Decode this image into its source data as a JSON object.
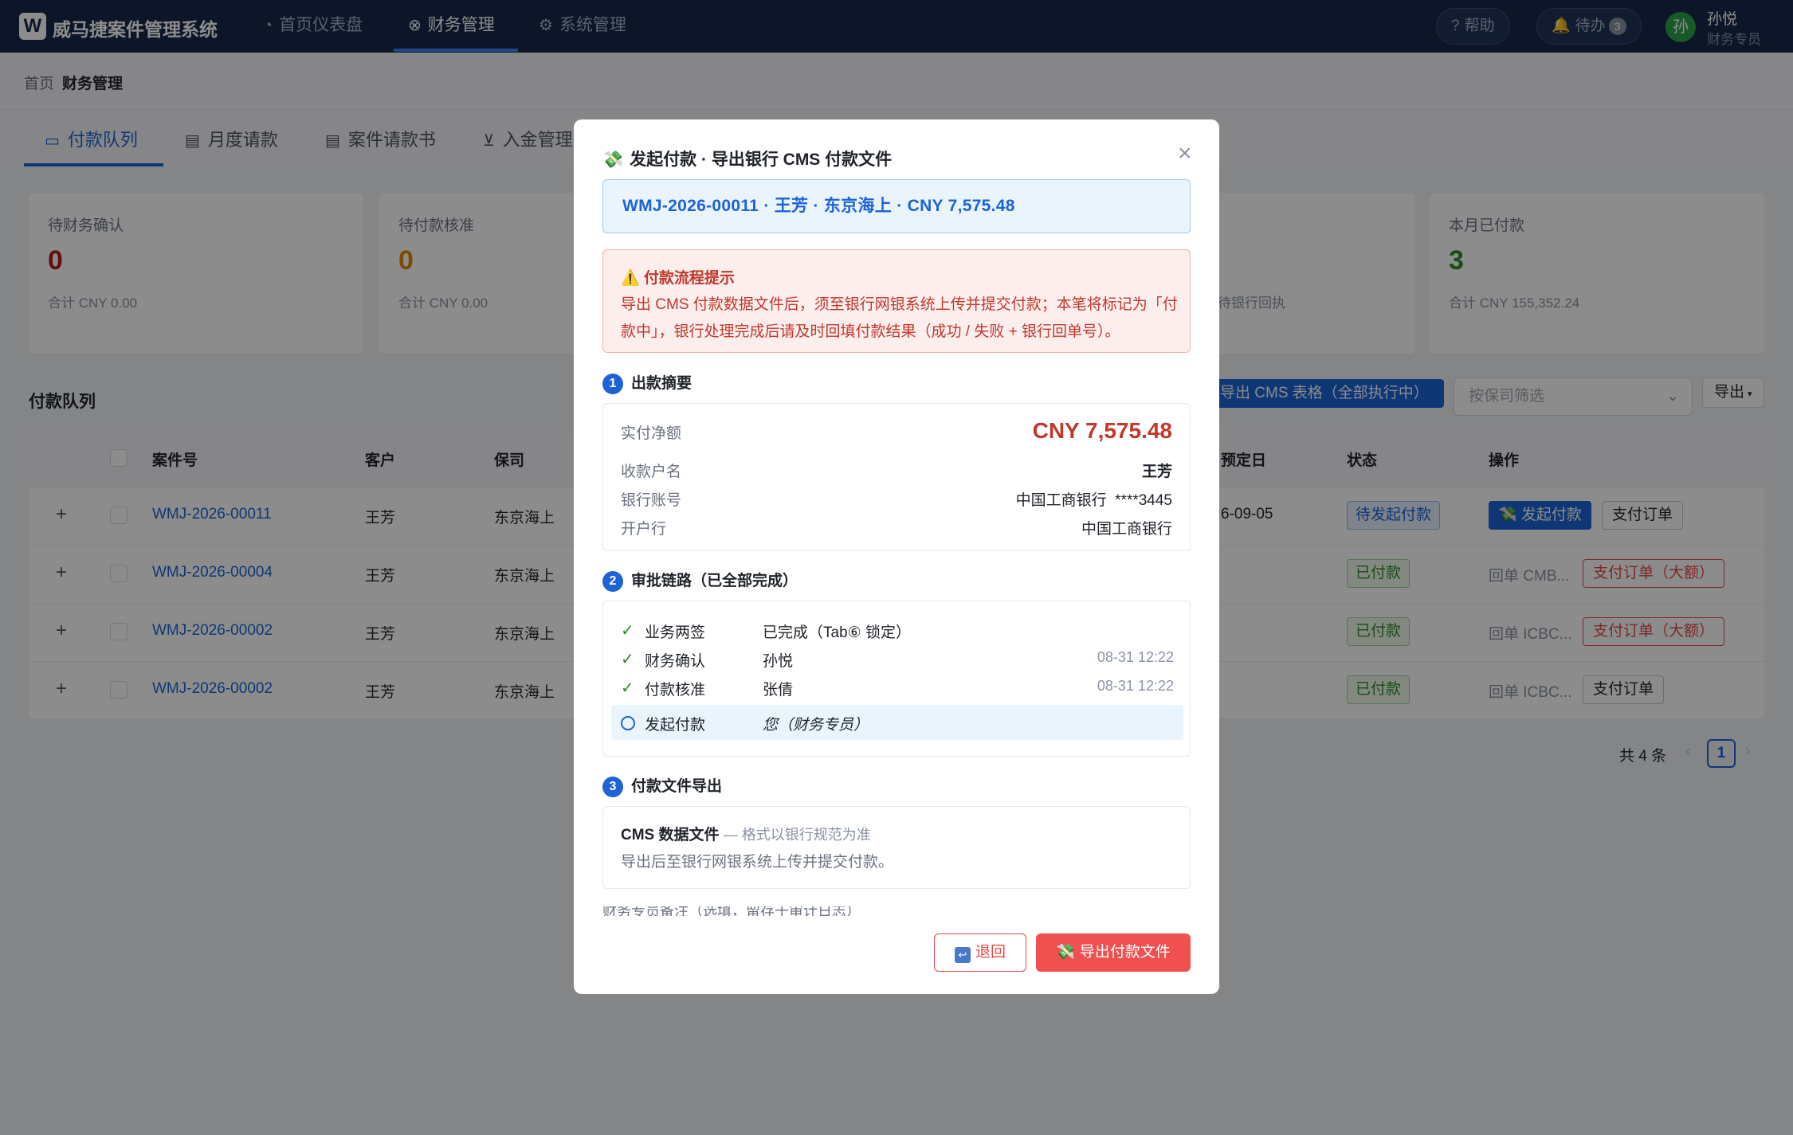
{
  "app": {
    "logo": "W",
    "title": "威马捷案件管理系统"
  },
  "nav": [
    {
      "label": "首页仪表盘",
      "icon": "◔"
    },
    {
      "label": "财务管理",
      "icon": "⊗"
    },
    {
      "label": "系统管理",
      "icon": "⚙"
    }
  ],
  "topbar": {
    "help": "帮助",
    "help_icon": "?",
    "todo": "待办",
    "todo_icon": "🔔",
    "todo_count": "3",
    "avatar": "孙",
    "user_name": "孙悦",
    "user_role": "财务专员"
  },
  "breadcrumb": [
    "首页",
    "财务管理"
  ],
  "tabs": [
    {
      "label": "付款队列",
      "icon": "▭"
    },
    {
      "label": "月度请款",
      "icon": "▤"
    },
    {
      "label": "案件请款书",
      "icon": "▤"
    },
    {
      "label": "入金管理",
      "icon": "⊻"
    }
  ],
  "stats": [
    {
      "label": "待财务确认",
      "value": "0",
      "sub": "合计 CNY 0.00",
      "color": "#b91c1c"
    },
    {
      "label": "待付款核准",
      "value": "0",
      "sub": "合计 CNY 0.00",
      "color": "#e08a00"
    },
    {
      "label": "",
      "value": "",
      "sub": "待银行回执",
      "color": "#1f2329"
    },
    {
      "label": "本月已付款",
      "value": "3",
      "sub": "合计 CNY 155,352.24",
      "color": "#2f8a2a"
    }
  ],
  "queue": {
    "title": "付款队列",
    "cms_button": "导出 CMS 表格（全部执行中）",
    "filter_placeholder": "按保司筛选",
    "export": "导出",
    "columns": [
      "案件号",
      "客户",
      "保司",
      "预定日",
      "状态",
      "操作"
    ],
    "rows": [
      {
        "case": "WMJ-2026-00011",
        "client": "王芳",
        "insurer": "东京海上",
        "date": "6-09-05",
        "status": "待发起付款",
        "status_type": "blue",
        "receipt": "",
        "op1": "💸 发起付款",
        "op1_type": "primary",
        "op2": "支付订单",
        "op2_type": "plain"
      },
      {
        "case": "WMJ-2026-00004",
        "client": "王芳",
        "insurer": "东京海上",
        "date": "",
        "status": "已付款",
        "status_type": "green",
        "receipt": "回单 CMB...",
        "op1": "",
        "op1_type": "",
        "op2": "支付订单（大额）",
        "op2_type": "danger"
      },
      {
        "case": "WMJ-2026-00002",
        "client": "王芳",
        "insurer": "东京海上",
        "date": "",
        "status": "已付款",
        "status_type": "green",
        "receipt": "回单 ICBC...",
        "op1": "",
        "op1_type": "",
        "op2": "支付订单（大额）",
        "op2_type": "danger"
      },
      {
        "case": "WMJ-2026-00002",
        "client": "王芳",
        "insurer": "东京海上",
        "date": "",
        "status": "已付款",
        "status_type": "green",
        "receipt": "回单 ICBC...",
        "op1": "",
        "op1_type": "",
        "op2": "支付订单",
        "op2_type": "plain"
      }
    ],
    "total": "共 4 条",
    "page": "1"
  },
  "modal": {
    "icon": "💸",
    "title": "发起付款 · 导出银行 CMS 付款文件",
    "header": "WMJ-2026-00011 · 王芳 · 东京海上 · CNY 7,575.48",
    "warning_title": "⚠️ 付款流程提示",
    "warning_body": "导出 CMS 付款数据文件后，须至银行网银系统上传并提交付款；本笔将标记为「付款中」，银行处理完成后请及时回填付款结果（成功 / 失败 + 银行回单号）。",
    "step1": {
      "num": "1",
      "title": "出款摘要"
    },
    "summary": [
      {
        "label": "实付净额",
        "value": "CNY 7,575.48"
      },
      {
        "label": "收款户名",
        "value": "王芳"
      },
      {
        "label": "银行账号",
        "value": "中国工商银行  ****3445"
      },
      {
        "label": "开户行",
        "value": "中国工商银行"
      }
    ],
    "step2": {
      "num": "2",
      "title": "审批链路（已全部完成）"
    },
    "approvals": [
      {
        "step": "业务两签",
        "who": "已完成（Tab⑥ 锁定）",
        "time": ""
      },
      {
        "step": "财务确认",
        "who": "孙悦",
        "time": "08-31 12:22"
      },
      {
        "step": "付款核准",
        "who": "张倩",
        "time": "08-31 12:22"
      },
      {
        "step": "发起付款",
        "who": "您（财务专员）",
        "time": ""
      }
    ],
    "step3": {
      "num": "3",
      "title": "付款文件导出"
    },
    "cms_title": "CMS 数据文件",
    "cms_sub": "— 格式以银行规范为准",
    "cms_desc": "导出后至银行网银系统上传并提交付款。",
    "note": "财务专员备注（选填，留存于审计日志）",
    "back": "退回",
    "back_icon": "↩",
    "confirm": "导出付款文件",
    "confirm_icon": "💸"
  }
}
